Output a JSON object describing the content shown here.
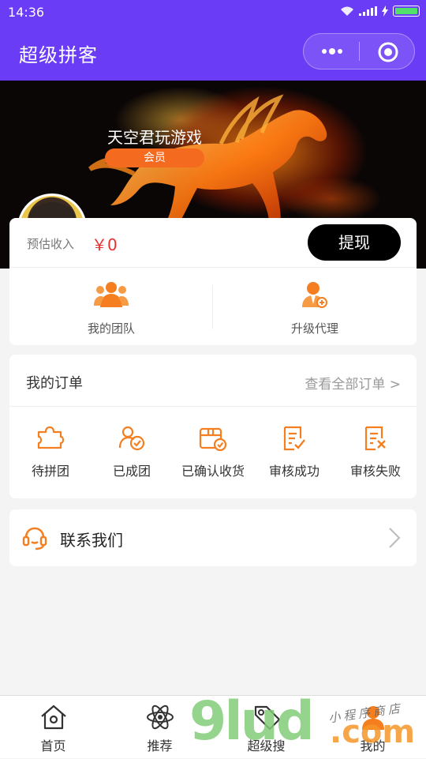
{
  "status_bar": {
    "time": "14:36"
  },
  "navbar": {
    "title": "超级拼客",
    "more_icon": "more-dots-icon",
    "close_icon": "target-close-icon"
  },
  "profile": {
    "username": "天空君玩游戏",
    "badge": "会员"
  },
  "earnings": {
    "label": "预估收入",
    "amount": "￥0",
    "withdraw_label": "提现"
  },
  "team": {
    "items": [
      {
        "label": "我的团队",
        "icon": "team-icon"
      },
      {
        "label": "升级代理",
        "icon": "agent-upgrade-icon"
      }
    ]
  },
  "orders": {
    "title": "我的订单",
    "view_all": "查看全部订单 >",
    "items": [
      {
        "label": "待拼团",
        "icon": "puzzle-icon"
      },
      {
        "label": "已成团",
        "icon": "group-check-icon"
      },
      {
        "label": "已确认收货",
        "icon": "box-check-icon"
      },
      {
        "label": "审核成功",
        "icon": "doc-check-icon"
      },
      {
        "label": "审核失败",
        "icon": "doc-fail-icon"
      }
    ]
  },
  "contact": {
    "label": "联系我们",
    "icon": "headset-icon"
  },
  "tabbar": {
    "items": [
      {
        "label": "首页",
        "icon": "home-icon"
      },
      {
        "label": "推荐",
        "icon": "atom-icon"
      },
      {
        "label": "超级搜",
        "icon": "tag-icon"
      },
      {
        "label": "我的",
        "icon": "user-icon"
      }
    ]
  },
  "watermark": {
    "number": "9lud",
    "domain": ".com",
    "shop": "小程序商店"
  },
  "colors": {
    "nav": "#6a3cf5",
    "accent": "#f57f20",
    "price": "#e8312f"
  }
}
